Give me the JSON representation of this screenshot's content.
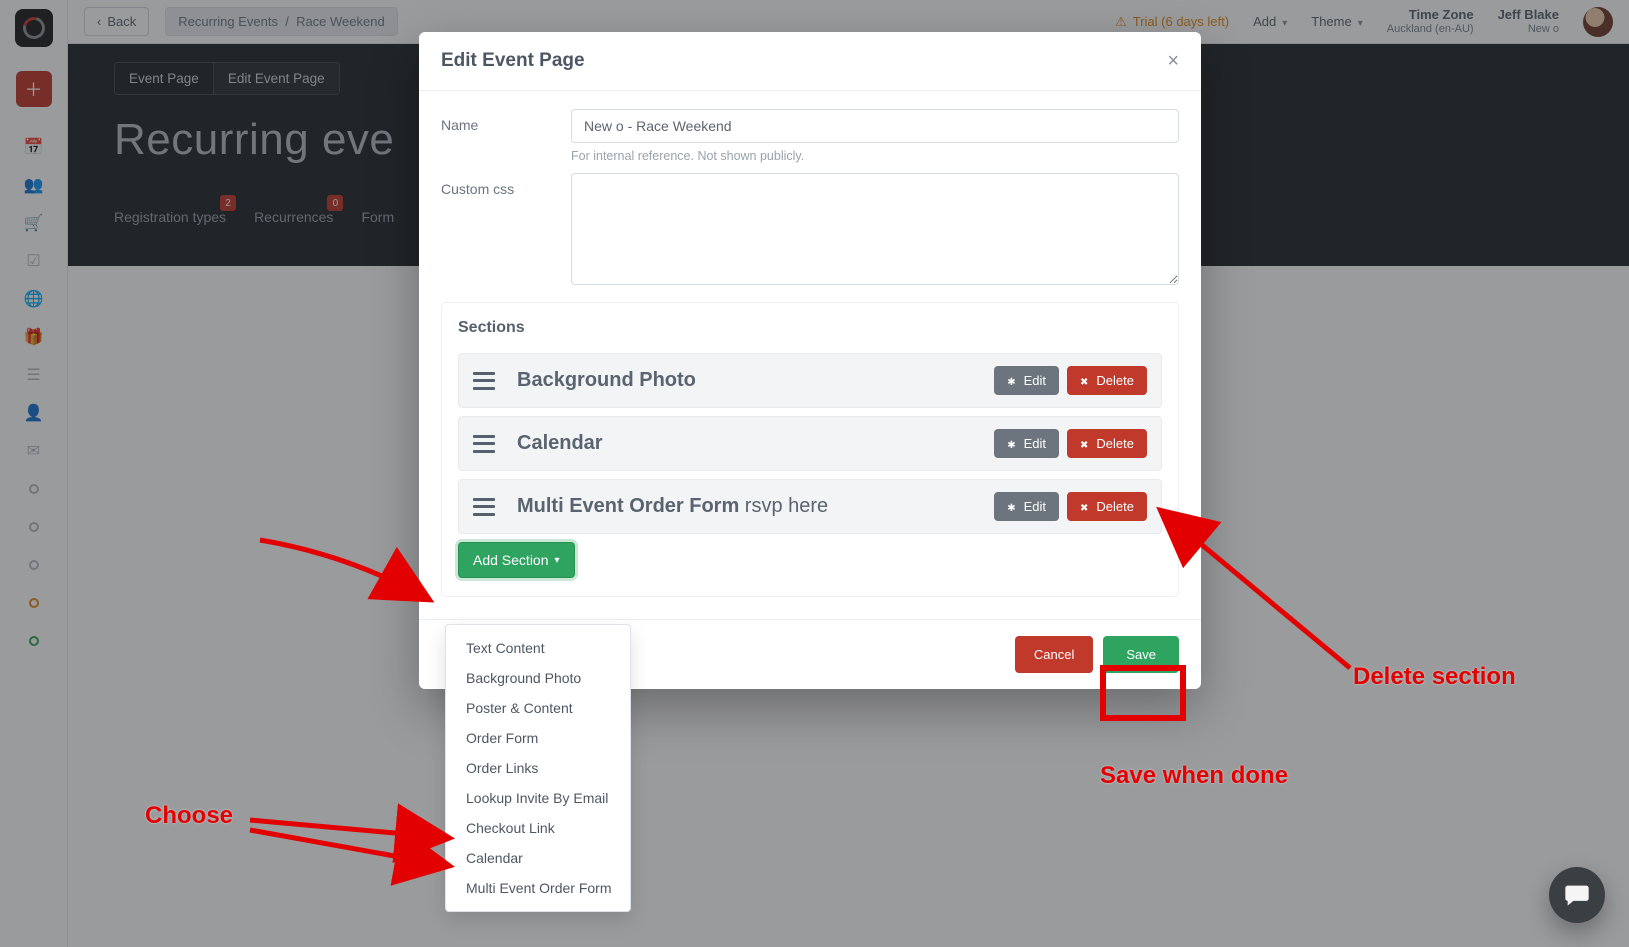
{
  "topbar": {
    "back": "Back",
    "breadcrumb_a": "Recurring Events",
    "breadcrumb_sep": "/",
    "breadcrumb_b": "Race Weekend",
    "trial_warn_icon": "⚠",
    "trial": "Trial (6 days left)",
    "add": "Add",
    "theme": "Theme",
    "tz_title": "Time Zone",
    "tz_value": "Auckland (en-AU)",
    "user_name": "Jeff Blake",
    "user_sub": "New o"
  },
  "rail": {
    "icons": [
      "calendar",
      "users",
      "cart",
      "check",
      "globe",
      "gift",
      "list",
      "person",
      "mail",
      "circle",
      "circle",
      "circle",
      "circle-orange",
      "circle-green"
    ]
  },
  "hero": {
    "chip_a": "Event Page",
    "chip_b": "Edit Event Page",
    "title": "Recurring eve",
    "tabs": [
      {
        "label": "Registration types",
        "badge": "2"
      },
      {
        "label": "Recurrences",
        "badge": "0"
      },
      {
        "label": "Form"
      }
    ]
  },
  "modal": {
    "title": "Edit Event Page",
    "name_label": "Name",
    "name_value": "New o - Race Weekend",
    "name_hint": "For internal reference. Not shown publicly.",
    "css_label": "Custom css",
    "sections_title": "Sections",
    "sections": [
      {
        "title": "Background Photo",
        "extra": ""
      },
      {
        "title": "Calendar",
        "extra": ""
      },
      {
        "title": "Multi Event Order Form",
        "extra": " rsvp here"
      }
    ],
    "edit": "Edit",
    "delete": "Delete",
    "add_section": "Add Section",
    "cancel": "Cancel",
    "save": "Save"
  },
  "menu": {
    "items": [
      "Text Content",
      "Background Photo",
      "Poster & Content",
      "Order Form",
      "Order Links",
      "Lookup Invite By Email",
      "Checkout Link",
      "Calendar",
      "Multi Event Order Form"
    ]
  },
  "anno": {
    "choose": "Choose",
    "delete": "Delete section",
    "save": "Save when done"
  }
}
